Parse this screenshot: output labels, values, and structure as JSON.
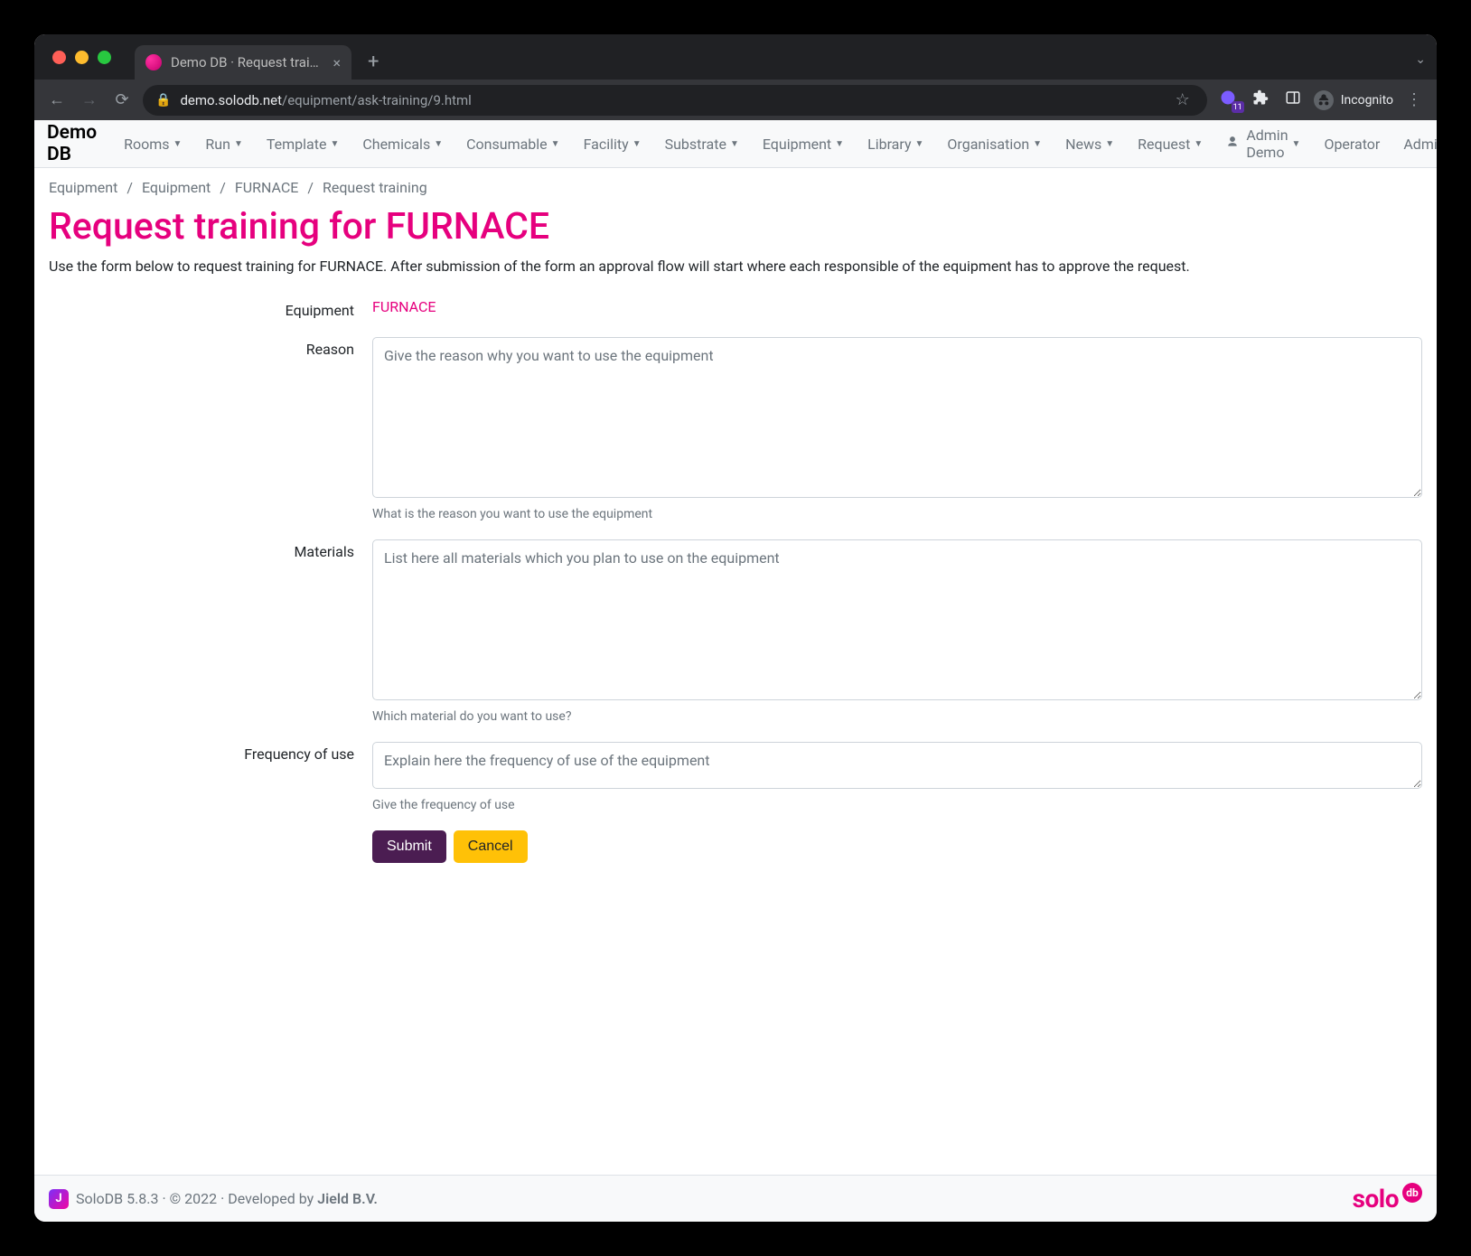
{
  "browser": {
    "tab_title": "Demo DB · Request training fo",
    "url_host": "demo.solodb.net",
    "url_path": "/equipment/ask-training/9.html",
    "ext_badge": "11",
    "incognito_label": "Incognito"
  },
  "navbar": {
    "brand": "Demo DB",
    "items": [
      {
        "label": "Rooms",
        "dropdown": true
      },
      {
        "label": "Run",
        "dropdown": true
      },
      {
        "label": "Template",
        "dropdown": true
      },
      {
        "label": "Chemicals",
        "dropdown": true
      },
      {
        "label": "Consumable",
        "dropdown": true
      },
      {
        "label": "Facility",
        "dropdown": true
      },
      {
        "label": "Substrate",
        "dropdown": true
      },
      {
        "label": "Equipment",
        "dropdown": true
      },
      {
        "label": "Library",
        "dropdown": true
      },
      {
        "label": "Organisation",
        "dropdown": true
      },
      {
        "label": "News",
        "dropdown": true
      },
      {
        "label": "Request",
        "dropdown": true
      }
    ],
    "right": {
      "user": "Admin Demo",
      "links": [
        "Operator",
        "Admin"
      ]
    }
  },
  "breadcrumb": [
    {
      "label": "Equipment"
    },
    {
      "label": "Equipment"
    },
    {
      "label": "FURNACE"
    },
    {
      "label": "Request training",
      "active": true
    }
  ],
  "page": {
    "title": "Request training for FURNACE",
    "lead": "Use the form below to request training for FURNACE. After submission of the form an approval flow will start where each responsible of the equipment has to approve the request."
  },
  "form": {
    "equipment": {
      "label": "Equipment",
      "value": "FURNACE"
    },
    "reason": {
      "label": "Reason",
      "placeholder": "Give the reason why you want to use the equipment",
      "help": "What is the reason you want to use the equipment"
    },
    "materials": {
      "label": "Materials",
      "placeholder": "List here all materials which you plan to use on the equipment",
      "help": "Which material do you want to use?"
    },
    "frequency": {
      "label": "Frequency of use",
      "placeholder": "Explain here the frequency of use of the equipment",
      "help": "Give the frequency of use"
    },
    "submit": "Submit",
    "cancel": "Cancel"
  },
  "footer": {
    "text_prefix": "SoloDB 5.8.3 · © 2022 · Developed by ",
    "link": "Jield B.V.",
    "logo_text": "solo",
    "logo_badge": "db"
  }
}
